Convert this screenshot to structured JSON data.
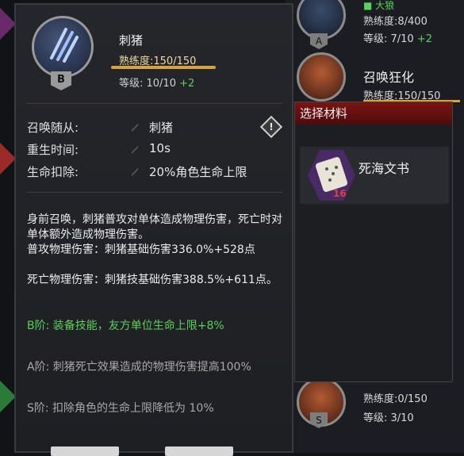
{
  "list": {
    "item1": {
      "prof": "熟练度:8/400",
      "level_prefix": "等级: 7/10 ",
      "level_bonus": "+2",
      "rank": "A",
      "name_partial": "■ 大狼"
    },
    "item2": {
      "name": "召唤狂化",
      "prof": "熟练度:150/150"
    },
    "item3": {
      "prof": "熟练度:0/150",
      "level": "等级: 3/10",
      "rank": "S"
    }
  },
  "skill": {
    "rank": "B",
    "name": "刺猪",
    "prof": "熟练度:150/150",
    "prof_fraction": 1.0,
    "level_prefix": "等级: 10/10 ",
    "level_bonus": "+2",
    "stats": [
      {
        "label": "召唤随从:",
        "value": "刺猪"
      },
      {
        "label": "重生时间:",
        "value": "10s"
      },
      {
        "label": "生命扣除:",
        "value": "20%角色生命上限"
      }
    ],
    "desc_main": "身前召唤，刺猪普攻对单体造成物理伤害，死亡时对单体额外造成物理伤害。",
    "desc_attack": "普攻物理伤害：刺猪基础伤害336.0%+528点",
    "desc_death": "死亡物理伤害：刺猪技基础伤害388.5%+611点。",
    "rank_b": "B阶: 装备技能，友方单位生命上限+8%",
    "rank_a": "A阶: 刺猪死亡效果造成的物理伤害提高100%",
    "rank_s": "S阶: 扣除角色的生命上限降低为 10%"
  },
  "popup": {
    "title": "选择材料",
    "material_name": "死海文书",
    "material_count": "16"
  },
  "colors": {
    "accent_gold": "#d8a33c",
    "bonus_green": "#5ad15a",
    "popup_red": "#7a1414"
  }
}
